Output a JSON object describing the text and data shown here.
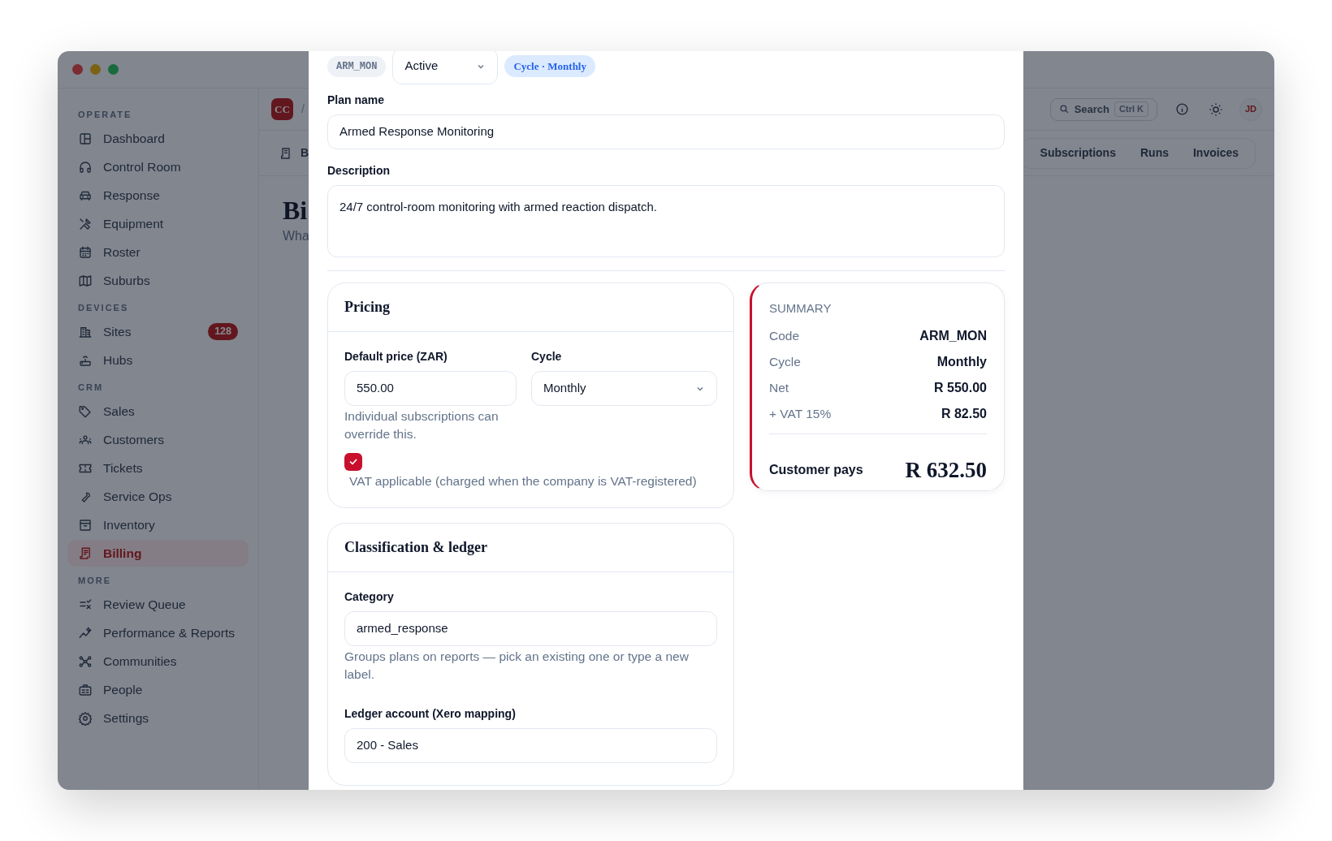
{
  "sidebar": {
    "sections": [
      {
        "title": "OPERATE",
        "items": [
          {
            "label": "Dashboard",
            "selected": false
          },
          {
            "label": "Control Room",
            "selected": false
          },
          {
            "label": "Response",
            "selected": false
          },
          {
            "label": "Equipment",
            "selected": false
          },
          {
            "label": "Roster",
            "selected": false
          },
          {
            "label": "Suburbs",
            "selected": false
          }
        ]
      },
      {
        "title": "DEVICES",
        "items": [
          {
            "label": "Sites",
            "selected": false,
            "badge": "128"
          },
          {
            "label": "Hubs",
            "selected": false
          }
        ]
      },
      {
        "title": "CRM",
        "items": [
          {
            "label": "Sales",
            "selected": false
          },
          {
            "label": "Customers",
            "selected": false
          },
          {
            "label": "Tickets",
            "selected": false
          },
          {
            "label": "Service Ops",
            "selected": false
          },
          {
            "label": "Inventory",
            "selected": false
          },
          {
            "label": "Billing",
            "selected": true
          }
        ]
      },
      {
        "title": "MORE",
        "items": [
          {
            "label": "Review Queue",
            "selected": false
          },
          {
            "label": "Performance & Reports",
            "selected": false
          },
          {
            "label": "Communities",
            "selected": false
          },
          {
            "label": "People",
            "selected": false
          },
          {
            "label": "Settings",
            "selected": false
          }
        ]
      }
    ]
  },
  "header": {
    "logo": "CC",
    "separator": "/",
    "search": {
      "placeholder": "Search",
      "shortcut": "Ctrl K"
    },
    "avatar": "JD"
  },
  "page": {
    "tab_label": "B",
    "title": "Bi",
    "subtitle": "Wha",
    "tabs": [
      {
        "label": "Subscriptions",
        "selected": false
      },
      {
        "label": "Runs",
        "selected": false
      },
      {
        "label": "Invoices",
        "selected": false
      }
    ]
  },
  "modal": {
    "code": "ARM_MON",
    "status": "Active",
    "cycle_badge": "Cycle · Monthly",
    "plan_name": {
      "label": "Plan name",
      "value": "Armed Response Monitoring"
    },
    "description": {
      "label": "Description",
      "value": "24/7 control-room monitoring with armed reaction dispatch."
    },
    "pricing": {
      "title": "Pricing",
      "price": {
        "label": "Default price (ZAR)",
        "value": "550.00",
        "help": "Individual subscriptions can override this."
      },
      "cycle": {
        "label": "Cycle",
        "value": "Monthly"
      },
      "vat": {
        "label": "VAT applicable (charged when the company is VAT-registered)",
        "checked": true
      }
    },
    "summary": {
      "title": "SUMMARY",
      "rows": [
        {
          "label": "Code",
          "value": "ARM_MON"
        },
        {
          "label": "Cycle",
          "value": "Monthly"
        },
        {
          "label": "Net",
          "value": "R 550.00"
        },
        {
          "label": "+ VAT 15%",
          "value": "R 82.50"
        }
      ],
      "total": {
        "label": "Customer pays",
        "value": "R 632.50"
      }
    },
    "classification": {
      "title": "Classification & ledger",
      "category": {
        "label": "Category",
        "value": "armed_response",
        "help": "Groups plans on reports — pick an existing one or type a new label."
      },
      "ledger": {
        "label": "Ledger account (Xero mapping)",
        "value": "200 - Sales"
      }
    }
  }
}
